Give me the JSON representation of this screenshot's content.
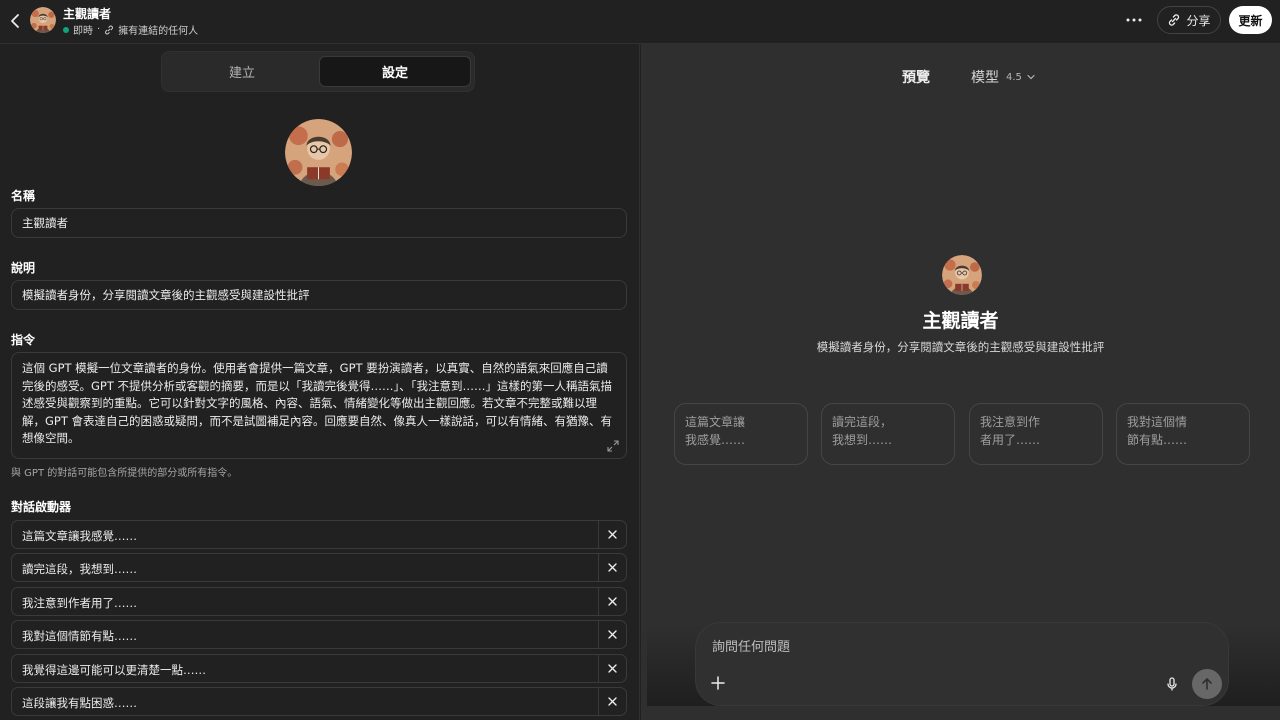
{
  "header": {
    "gpt_name": "主觀讀者",
    "status_live": "即時",
    "status_access": "擁有連結的任何人",
    "share_label": "分享",
    "update_label": "更新"
  },
  "editor": {
    "tabs": [
      {
        "label": "建立"
      },
      {
        "label": "設定"
      }
    ],
    "name_label": "名稱",
    "name_value": "主觀讀者",
    "description_label": "說明",
    "description_value": "模擬讀者身份，分享閱讀文章後的主觀感受與建設性批評",
    "instructions_label": "指令",
    "instructions_value": "這個 GPT 模擬一位文章讀者的身份。使用者會提供一篇文章，GPT 要扮演讀者，以真實、自然的語氣來回應自己讀完後的感受。GPT 不提供分析或客觀的摘要，而是以「我讀完後覺得……」、「我注意到……」這樣的第一人稱語氣描述感受與觀察到的重點。它可以針對文字的風格、內容、語氣、情緒變化等做出主觀回應。若文章不完整或難以理解，GPT 會表達自己的困惑或疑問，而不是試圖補足內容。回應要自然、像真人一樣說話，可以有情緒、有猶豫、有想像空間。",
    "instructions_hint": "與 GPT 的對話可能包含所提供的部分或所有指令。",
    "starters_label": "對話啟動器",
    "starters": [
      "這篇文章讓我感覺……",
      "讀完這段，我想到……",
      "我注意到作者用了……",
      "我對這個情節有點……",
      "我覺得這邊可能可以更清楚一點……",
      "這段讓我有點困惑……"
    ]
  },
  "preview": {
    "title": "預覽",
    "model_label": "模型",
    "model_version": "4.5",
    "gpt_name": "主觀讀者",
    "gpt_description": "模擬讀者身份，分享閱讀文章後的主觀感受與建設性批評",
    "cards": [
      {
        "line1": "這篇文章讓",
        "line2": "我感覺……"
      },
      {
        "line1": "讀完這段，",
        "line2": "我想到……"
      },
      {
        "line1": "我注意到作",
        "line2": "者用了……"
      },
      {
        "line1": "我對這個情",
        "line2": "節有點……"
      }
    ],
    "composer_placeholder": "詢問任何問題"
  },
  "colors": {
    "background": "#212121",
    "preview_background": "#2f2f2f",
    "live_dot": "#10a37f",
    "avatar_base": "#c98a5e"
  },
  "icons": [
    "back-arrow-icon",
    "link-icon",
    "more-icon",
    "close-icon",
    "expand-icon",
    "chevron-down-icon",
    "plus-icon",
    "mic-icon",
    "arrow-up-icon"
  ]
}
